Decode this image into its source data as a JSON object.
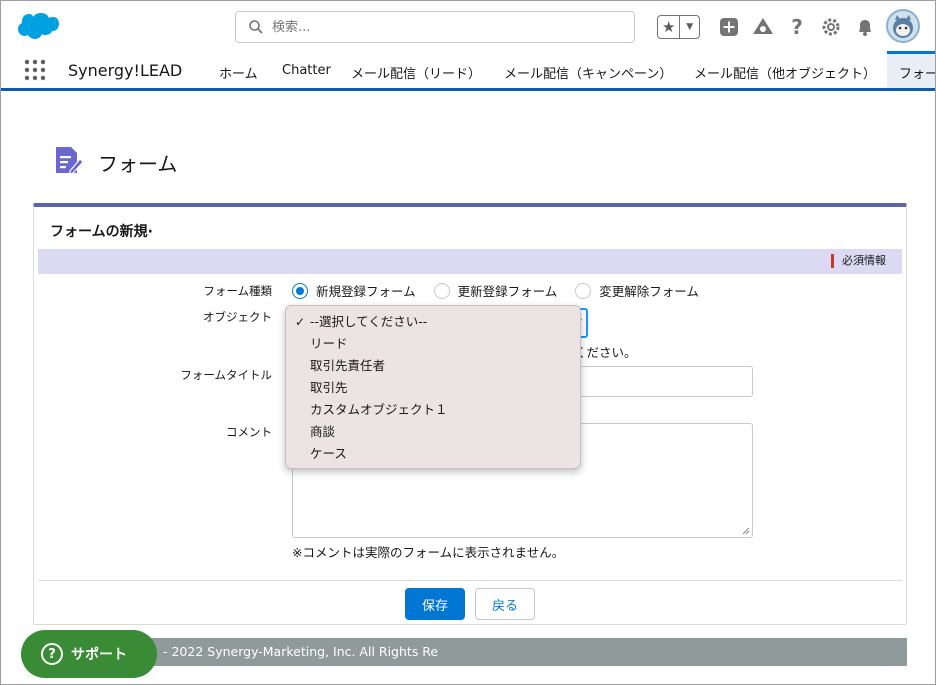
{
  "header": {
    "search_placeholder": "検索...",
    "tools": [
      "favorites-star-icon",
      "add-icon",
      "trailhead-icon",
      "help-icon",
      "settings-icon",
      "notifications-bell-icon"
    ]
  },
  "nav": {
    "app_name": "Synergy!LEAD",
    "items": [
      "ホーム",
      "Chatter",
      "メール配信（リード）",
      "メール配信（キャンペーン）",
      "メール配信（他オブジェクト）"
    ],
    "active": "フォー"
  },
  "page": {
    "title": "フォーム"
  },
  "card": {
    "title": "フォームの新規·",
    "required_label": "必須情報",
    "form_type_label": "フォーム種類",
    "form_types": [
      "新規登録フォーム",
      "更新登録フォーム",
      "変更解除フォーム"
    ],
    "selected_form_type": "新規登録フォーム",
    "object_label": "オブジェクト",
    "object_hint_tail": "ください。",
    "form_title_label": "フォームタイトル",
    "comment_label": "コメント",
    "comment_note": "※コメントは実際のフォームに表示されません。",
    "save_label": "保存",
    "back_label": "戻る"
  },
  "dropdown": {
    "options": [
      "--選択してください--",
      "リード",
      "取引先責任者",
      "取引先",
      "カスタムオブジェクト１",
      "商談",
      "ケース"
    ],
    "checked_index": 0,
    "check_mark": "✓"
  },
  "footer": {
    "text": "- 2022 Synergy-Marketing, Inc. All Rights Re"
  },
  "support": {
    "label": "サポート",
    "icon": "?"
  },
  "colors": {
    "brand_blue": "#0176d3",
    "card_accent": "#5867a8",
    "support_green": "#3a8b35",
    "required_red": "#c23934"
  }
}
